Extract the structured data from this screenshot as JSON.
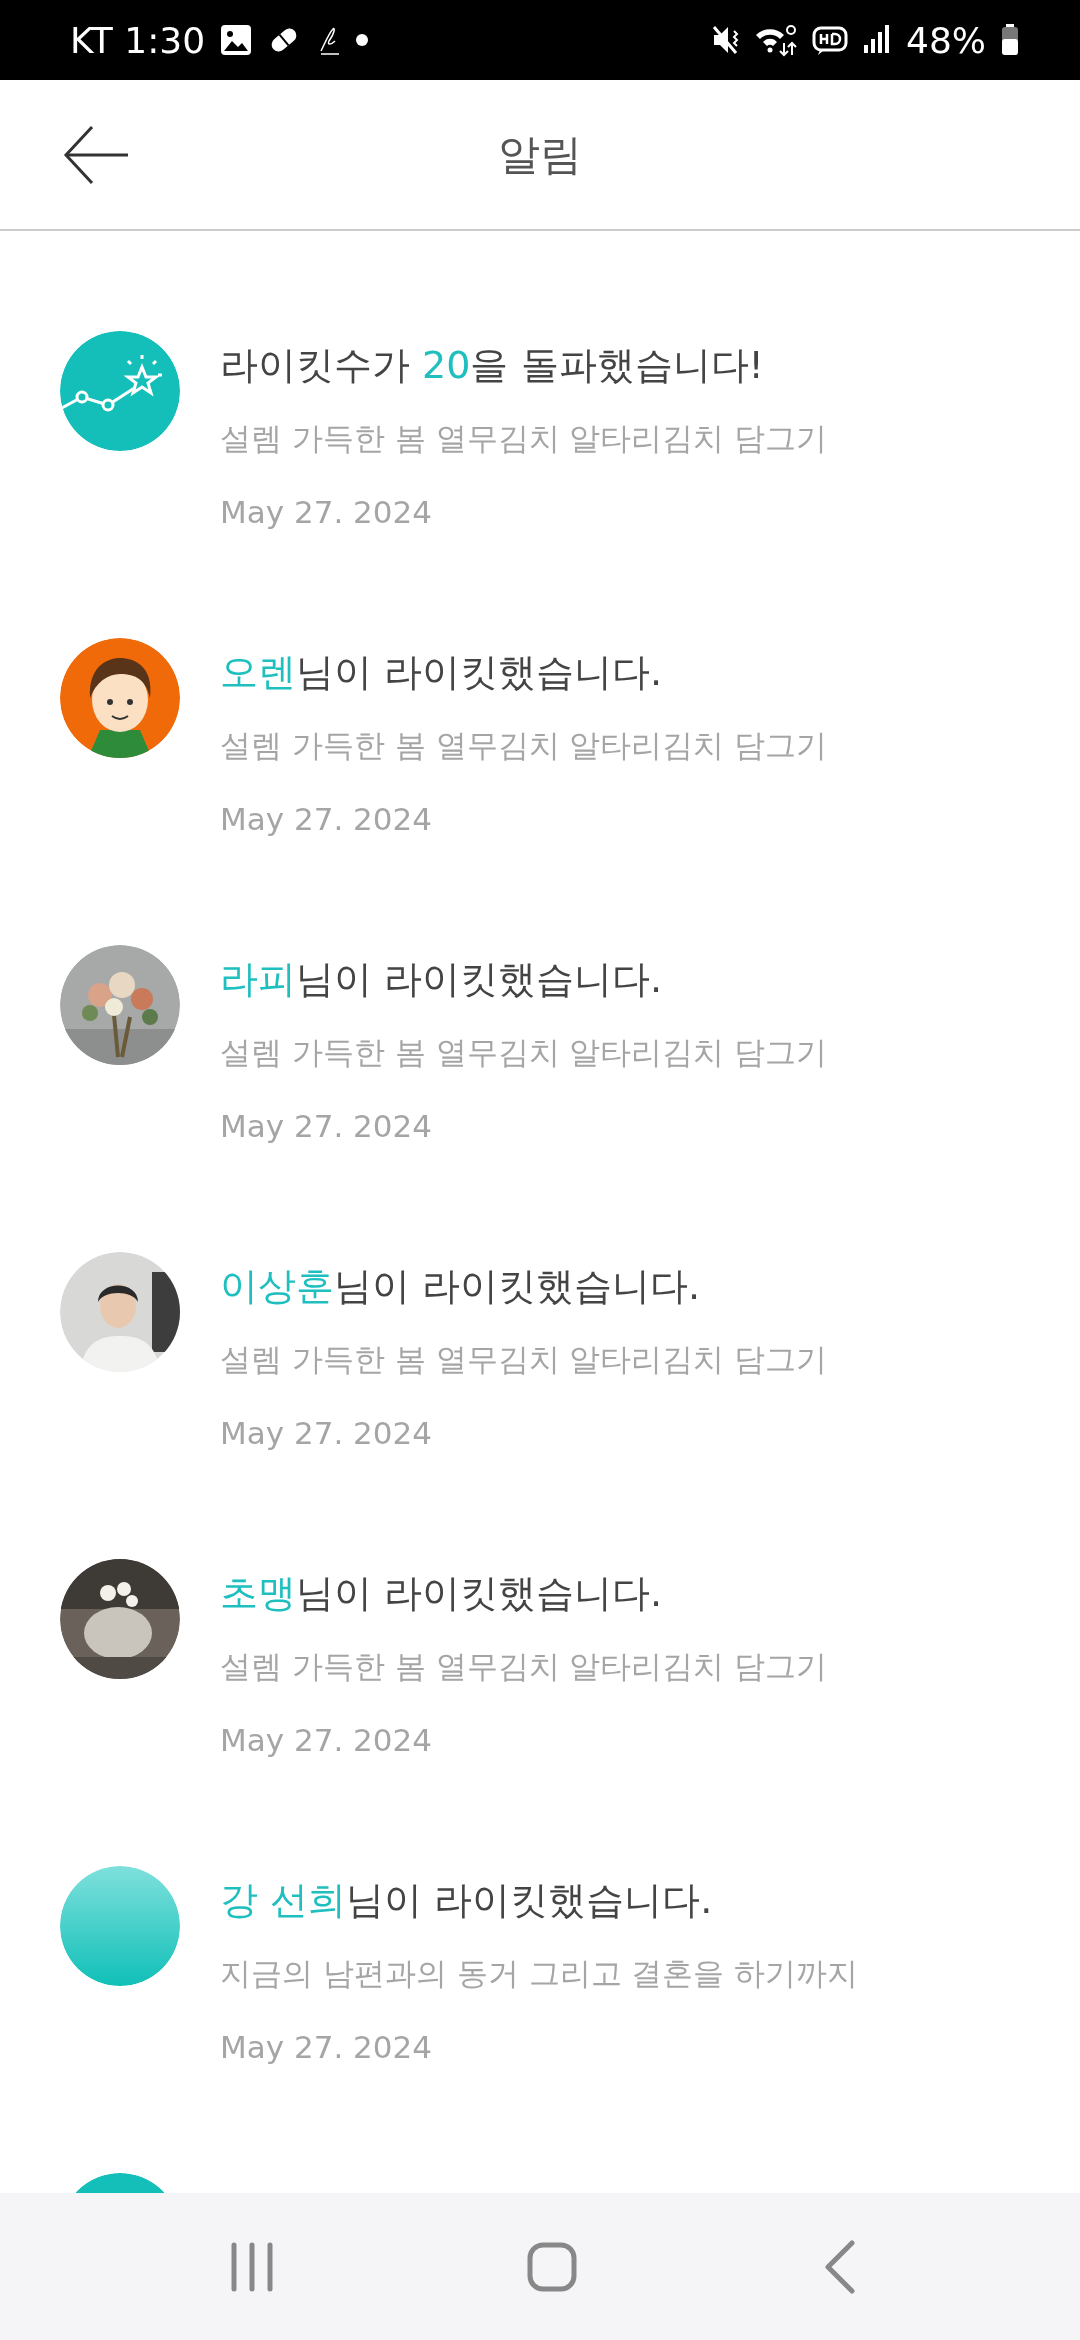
{
  "status_bar": {
    "carrier_time": "KT 1:30",
    "battery": "48%"
  },
  "app_bar": {
    "title": "알림"
  },
  "notifications": [
    {
      "avatar": {
        "kind": "milestone"
      },
      "title": [
        {
          "text": "라이킷수가 ",
          "accent": false
        },
        {
          "text": "20",
          "accent": true
        },
        {
          "text": "을 돌파했습니다!",
          "accent": false
        }
      ],
      "subtitle": "설렘 가득한 봄 열무김치 알타리김치 담그기",
      "date": "May 27. 2024"
    },
    {
      "avatar": {
        "kind": "cartoon"
      },
      "title": [
        {
          "text": "오렌",
          "accent": true
        },
        {
          "text": "님이 라이킷했습니다.",
          "accent": false
        }
      ],
      "subtitle": "설렘 가득한 봄 열무김치 알타리김치 담그기",
      "date": "May 27. 2024"
    },
    {
      "avatar": {
        "kind": "picture"
      },
      "title": [
        {
          "text": "라피",
          "accent": true
        },
        {
          "text": "님이 라이킷했습니다.",
          "accent": false
        }
      ],
      "subtitle": "설렘 가득한 봄 열무김치 알타리김치 담그기",
      "date": "May 27. 2024"
    },
    {
      "avatar": {
        "kind": "picture"
      },
      "title": [
        {
          "text": "이상훈",
          "accent": true
        },
        {
          "text": "님이 라이킷했습니다.",
          "accent": false
        }
      ],
      "subtitle": "설렘 가득한 봄 열무김치 알타리김치 담그기",
      "date": "May 27. 2024"
    },
    {
      "avatar": {
        "kind": "picture"
      },
      "title": [
        {
          "text": "초맹",
          "accent": true
        },
        {
          "text": "님이 라이킷했습니다.",
          "accent": false
        }
      ],
      "subtitle": "설렘 가득한 봄 열무김치 알타리김치 담그기",
      "date": "May 27. 2024"
    },
    {
      "avatar": {
        "kind": "plain"
      },
      "title": [
        {
          "text": "강 선희",
          "accent": true
        },
        {
          "text": "님이 라이킷했습니다.",
          "accent": false
        }
      ],
      "subtitle": "지금의 남편과의 동거 그리고 결혼을 하기까지",
      "date": "May 27. 2024"
    },
    {
      "avatar": {
        "kind": "milestone"
      }
    }
  ]
}
